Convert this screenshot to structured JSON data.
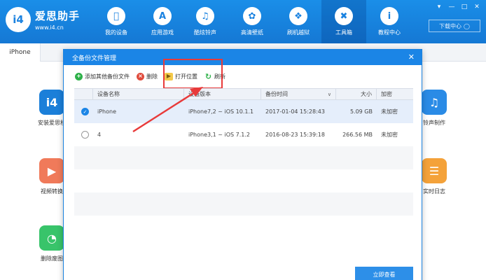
{
  "app": {
    "name": "爱思助手",
    "url": "www.i4.cn"
  },
  "nav": [
    {
      "label": "我的设备",
      "icon": "apple-icon"
    },
    {
      "label": "应用游戏",
      "icon": "appstore-icon"
    },
    {
      "label": "酷炫铃声",
      "icon": "bell-icon"
    },
    {
      "label": "高清壁纸",
      "icon": "flower-icon"
    },
    {
      "label": "刷机越狱",
      "icon": "dropbox-icon"
    },
    {
      "label": "工具箱",
      "icon": "tools-icon",
      "active": true
    },
    {
      "label": "教程中心",
      "icon": "info-icon"
    }
  ],
  "top_right": {
    "download_center": "下载中心"
  },
  "device_tab": "iPhone",
  "bg_apps": {
    "left": [
      "安装爱思移",
      "视频转换",
      "删除废图"
    ],
    "right": [
      "铃声制作",
      "实时日志"
    ]
  },
  "dialog": {
    "title": "全备份文件管理",
    "toolbar": {
      "add": "添加其他备份文件",
      "delete": "删除",
      "open": "打开位置",
      "refresh": "刷新"
    },
    "columns": {
      "name": "设备名称",
      "version": "设备版本",
      "time": "备份时间",
      "size": "大小",
      "encrypt": "加密"
    },
    "rows": [
      {
        "name": "iPhone",
        "version": "iPhone7,2 ~ iOS 10.1.1",
        "time": "2017-01-04 15:28:43",
        "size": "5.09 GB",
        "encrypt": "未加密",
        "selected": true
      },
      {
        "name": "4",
        "version": "iPhone3,1 ~ iOS 7.1.2",
        "time": "2016-08-23 15:39:18",
        "size": "266.56 MB",
        "encrypt": "未加密",
        "selected": false
      }
    ],
    "primary_button": "立即查看"
  },
  "colors": {
    "brand_blue": "#1a82e0",
    "highlight_red": "#e83a3a"
  }
}
